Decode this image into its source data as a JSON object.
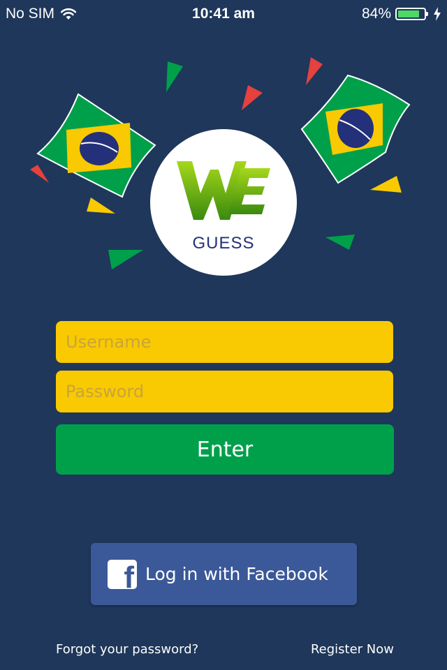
{
  "status_bar": {
    "carrier": "No SIM",
    "time": "10:41 am",
    "battery_percent": "84%",
    "battery_level": 0.84,
    "battery_color": "#4cd964",
    "icons": [
      "wifi-icon",
      "battery-icon",
      "charging-icon"
    ]
  },
  "logo": {
    "wordmark": "WE",
    "text": "GUESS",
    "colors": {
      "green_light": "#8fcf1a",
      "green_dark": "#3a8a0e",
      "text": "#24307a"
    }
  },
  "login_form": {
    "username_placeholder": "Username",
    "password_placeholder": "Password",
    "enter_label": "Enter"
  },
  "facebook": {
    "icon": "facebook-icon",
    "label": "Log in with Facebook"
  },
  "footer": {
    "forgot_label": "Forgot your password?",
    "register_label": "Register Now"
  },
  "colors": {
    "background": "#1e375a",
    "field": "#f9c901",
    "enter": "#00a04b",
    "facebook": "#3b5998"
  }
}
